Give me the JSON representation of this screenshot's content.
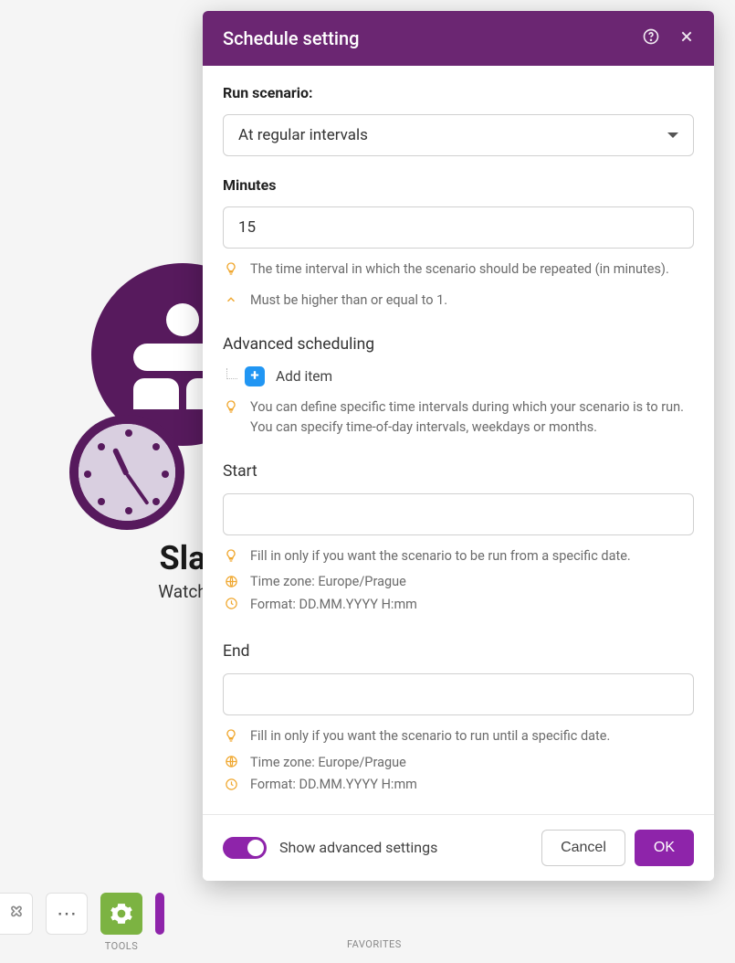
{
  "module": {
    "title": "Sla",
    "subtitle": "Watch"
  },
  "toolbar": {
    "tools_label": "TOOLS",
    "favorites_label": "FAVORITES"
  },
  "modal": {
    "title": "Schedule setting",
    "run_scenario_label": "Run scenario:",
    "run_scenario_value": "At regular intervals",
    "minutes_label": "Minutes",
    "minutes_value": "15",
    "minutes_hint": "The time interval in which the scenario should be repeated (in minutes).",
    "minutes_constraint": "Must be higher than or equal to 1.",
    "advanced_scheduling_label": "Advanced scheduling",
    "add_item_label": "Add item",
    "advanced_hint": "You can define specific time intervals during which your scenario is to run. You can specify time-of-day intervals, weekdays or months.",
    "start_label": "Start",
    "start_value": "",
    "start_hint": "Fill in only if you want the scenario to be run from a specific date.",
    "start_tz": "Time zone: Europe/Prague",
    "start_format": "Format: DD.MM.YYYY H:mm",
    "end_label": "End",
    "end_value": "",
    "end_hint": "Fill in only if you want the scenario to run until a specific date.",
    "end_tz": "Time zone: Europe/Prague",
    "end_format": "Format: DD.MM.YYYY H:mm",
    "show_advanced_label": "Show advanced settings",
    "cancel_label": "Cancel",
    "ok_label": "OK"
  }
}
